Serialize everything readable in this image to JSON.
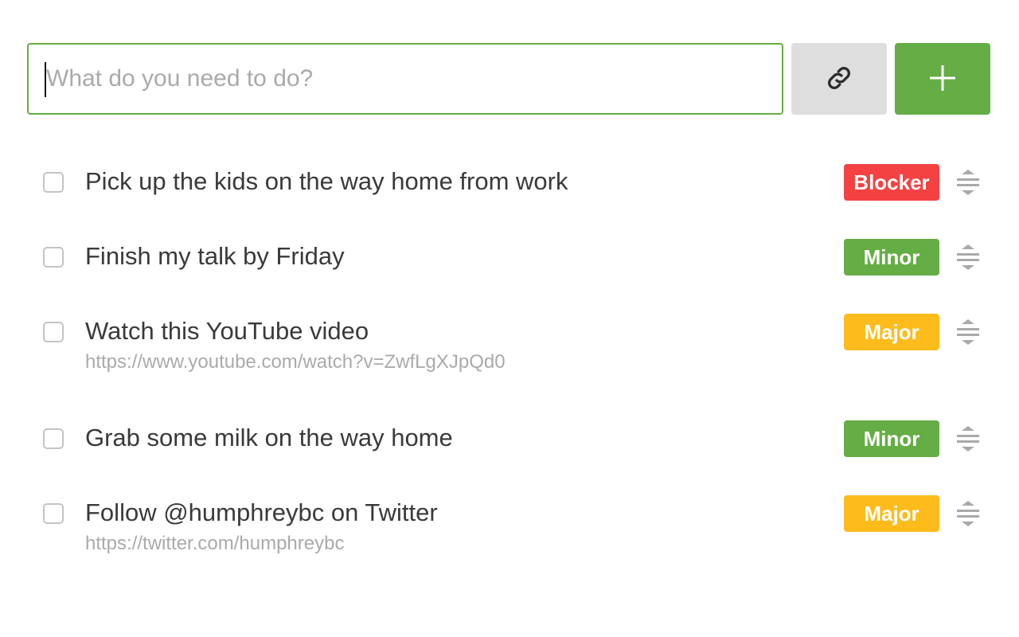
{
  "input": {
    "placeholder": "What do you need to do?",
    "value": ""
  },
  "buttons": {
    "link_icon": "link-icon",
    "add_icon": "plus-icon"
  },
  "colors": {
    "accent": "#65ad45",
    "blocker": "#f44242",
    "minor": "#65ad45",
    "major": "#fdbc1c"
  },
  "tasks": [
    {
      "title": "Pick up the kids on the way home from work",
      "url": "",
      "priority": "Blocker",
      "priority_color": "#f44242"
    },
    {
      "title": "Finish my talk by Friday",
      "url": "",
      "priority": "Minor",
      "priority_color": "#65ad45"
    },
    {
      "title": "Watch this YouTube video",
      "url": "https://www.youtube.com/watch?v=ZwfLgXJpQd0",
      "priority": "Major",
      "priority_color": "#fdbc1c"
    },
    {
      "title": "Grab some milk on the way home",
      "url": "",
      "priority": "Minor",
      "priority_color": "#65ad45"
    },
    {
      "title": "Follow @humphreybc on Twitter",
      "url": "https://twitter.com/humphreybc",
      "priority": "Major",
      "priority_color": "#fdbc1c"
    }
  ]
}
